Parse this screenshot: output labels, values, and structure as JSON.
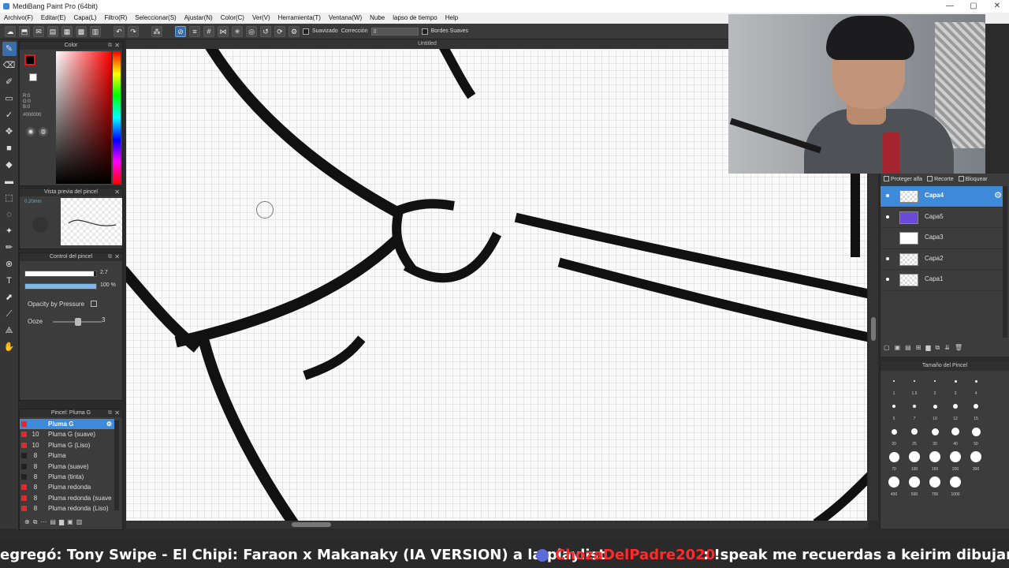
{
  "window": {
    "title": "MediBang Paint Pro (64bit)",
    "controls": [
      "—",
      "▢",
      "✕"
    ]
  },
  "menubar": [
    "Archivo(F)",
    "Editar(E)",
    "Capa(L)",
    "Filtro(R)",
    "Seleccionar(S)",
    "Ajustar(N)",
    "Color(C)",
    "Ver(V)",
    "Herramienta(T)",
    "Ventana(W)",
    "Nube",
    "lapso de tiempo",
    "Help"
  ],
  "toolbar": {
    "antialias_label": "Suavizado",
    "correction_label": "Corrección",
    "correction_value": "0",
    "soft_edges_label": "Bordes Suaves"
  },
  "panels": {
    "color": {
      "title": "Color",
      "r": "R:0",
      "g": "G:0",
      "b": "B:0",
      "hex": "#000000",
      "fg_color": "#000000",
      "accent": "#e01919"
    },
    "brush_preview": {
      "title": "Vista previa del pincel",
      "size": "0.20mm"
    },
    "brush_control": {
      "title": "Control del pincel",
      "size_value": "2.7",
      "opacity_value": "100 %",
      "opacity_fraction": 1.0,
      "size_fraction": 0.97,
      "opacity_pressure_label": "Opacity by Pressure",
      "ooze_label": "Ooze",
      "ooze_value": "3"
    },
    "brush_list": {
      "title": "Pincel: Pluma G",
      "items": [
        {
          "size": "",
          "name": "Pluma G",
          "selected": true
        },
        {
          "size": "10",
          "name": "Pluma G (suave)"
        },
        {
          "size": "10",
          "name": "Pluma G (Liso)"
        },
        {
          "size": "8",
          "name": "Pluma"
        },
        {
          "size": "8",
          "name": "Pluma (suave)"
        },
        {
          "size": "8",
          "name": "Pluma (tinta)"
        },
        {
          "size": "8",
          "name": "Pluma redonda"
        },
        {
          "size": "8",
          "name": "Pluma redonda (suave"
        },
        {
          "size": "8",
          "name": "Pluma redonda (Liso)"
        }
      ]
    },
    "layers": {
      "protect_alpha": "Proteger alfa",
      "clip": "Recorte",
      "lock": "Bloquear",
      "items": [
        {
          "name": "Capa4",
          "selected": true
        },
        {
          "name": "Capa5"
        },
        {
          "name": "Capa3"
        },
        {
          "name": "Capa2"
        },
        {
          "name": "Capa1"
        }
      ]
    },
    "brush_size": {
      "title": "Tamaño del Pincel",
      "sizes": [
        "1",
        "1.5",
        "2",
        "3",
        "4",
        "5",
        "7",
        "10",
        "12",
        "15",
        "20",
        "25",
        "30",
        "40",
        "50",
        "70",
        "100",
        "150",
        "200",
        "300",
        "400",
        "500",
        "700",
        "1000"
      ]
    }
  },
  "canvas": {
    "title": "Untitled"
  },
  "ticker": {
    "text": "egregó: Tony Swipe - El Chipi: Faraon x Makanaky (IA VERSION) a la playlist",
    "user": "ChozaDelPadre2020",
    "message": ": !speak me recuerdas a keirim dibujando"
  }
}
